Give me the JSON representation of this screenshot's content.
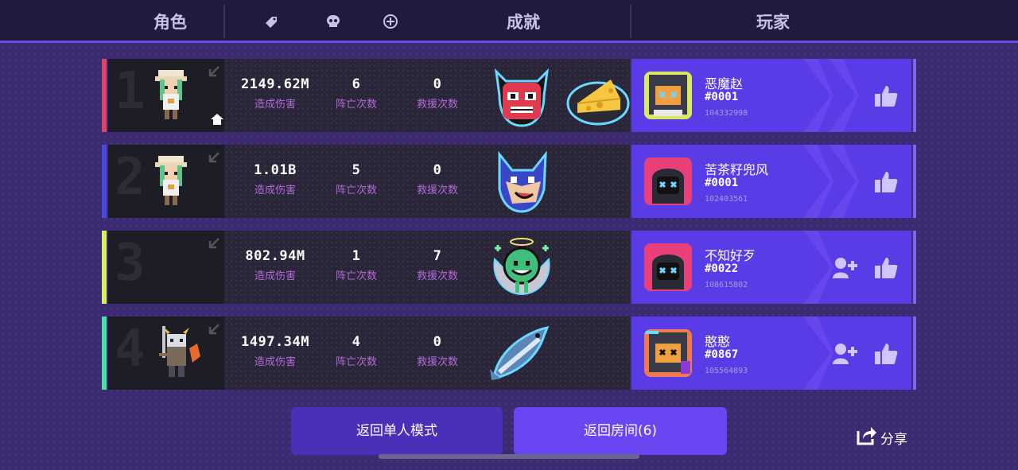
{
  "header": {
    "col_role": "角色",
    "col_achievement": "成就",
    "col_player": "玩家",
    "icons": [
      "tag-icon",
      "skull-icon",
      "plus-circle-icon"
    ]
  },
  "stat_labels": {
    "damage": "造成伤害",
    "deaths": "阵亡次数",
    "rescues": "救援次数"
  },
  "rows": [
    {
      "rank": "1",
      "accent": "#e0436a",
      "damage": "2149.62M",
      "deaths": "6",
      "rescues": "0",
      "badges": [
        "demon-face-badge",
        "cheese-badge"
      ],
      "player": {
        "name": "恶魔赵",
        "tag": "#0001",
        "id": "104332998"
      },
      "is_host": true,
      "addable": false
    },
    {
      "rank": "2",
      "accent": "#4a4ae0",
      "damage": "1.01B",
      "deaths": "5",
      "rescues": "0",
      "badges": [
        "wolf-badge"
      ],
      "player": {
        "name": "苦茶籽兜风",
        "tag": "#0001",
        "id": "102403561"
      },
      "is_host": false,
      "addable": false
    },
    {
      "rank": "3",
      "accent": "#d8f060",
      "damage": "802.94M",
      "deaths": "1",
      "rescues": "7",
      "badges": [
        "angel-blob-badge"
      ],
      "player": {
        "name": "不知好歹",
        "tag": "#0022",
        "id": "108615802"
      },
      "is_host": false,
      "addable": true
    },
    {
      "rank": "4",
      "accent": "#4ae0a8",
      "damage": "1497.34M",
      "deaths": "4",
      "rescues": "0",
      "badges": [
        "fish-badge"
      ],
      "player": {
        "name": "憨憨",
        "tag": "#0867",
        "id": "105564893"
      },
      "is_host": false,
      "addable": true
    }
  ],
  "footer": {
    "back_single": "返回单人模式",
    "back_room": "返回房间(6)",
    "share": "分享"
  },
  "colors": {
    "background": "#3c2b72",
    "player_panel": "#5a3ce6",
    "stat_label": "#b36ad8"
  }
}
